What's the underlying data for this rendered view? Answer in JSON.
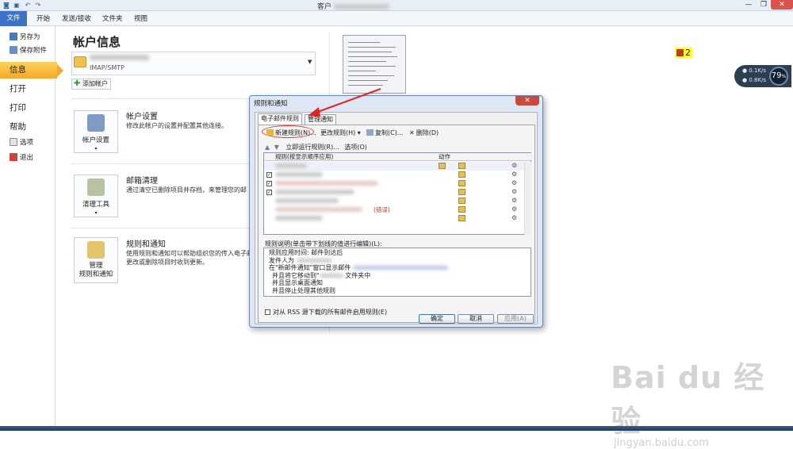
{
  "window": {
    "title": "客户",
    "quick_access": [
      "save-icon",
      "undo-icon",
      "redo-icon"
    ],
    "controls": [
      "—",
      "❐",
      "✕"
    ]
  },
  "ribbon": {
    "tabs": [
      "文件",
      "开始",
      "发送/接收",
      "文件夹",
      "视图"
    ]
  },
  "nav": {
    "save_as": "另存为",
    "save_attachments": "保存附件",
    "info": "信息",
    "open": "打开",
    "print": "打印",
    "help": "帮助",
    "options": "选项",
    "exit": "退出"
  },
  "main": {
    "heading": "帐户信息",
    "account_type": "IMAP/SMTP",
    "add_account": "添加帐户",
    "sections": [
      {
        "button": "帐户设置",
        "title": "帐户设置",
        "desc": "修改此帐户的设置并配置其他连接。"
      },
      {
        "button": "清理工具",
        "title": "邮箱清理",
        "desc": "通过清空已删除项目并存档，来管理您的邮"
      },
      {
        "button_line1": "管理",
        "button_line2": "规则和通知",
        "title": "规则和通知",
        "desc1": "使用规则和通知可以帮助组织您的传入电子邮",
        "desc2": "更改或删除项目时收到更新。"
      }
    ]
  },
  "badge": {
    "count": "2"
  },
  "network": {
    "up": "0.1",
    "down": "0.8",
    "unit": "K/s",
    "percent": "79",
    "percent_unit": "%"
  },
  "dialog": {
    "title": "规则和通知",
    "close": "✕",
    "tabs": [
      "电子邮件规则",
      "管理通知"
    ],
    "toolbar": {
      "new_rule": "新建规则(N)...",
      "change_rule": "更改规则(H) ▾",
      "copy": "复制(C)...",
      "delete": "删除(D)"
    },
    "run_rules": "立即运行规则(R)...",
    "options": "选项(O)",
    "table": {
      "col_rule": "规则(按显示顺序应用)",
      "col_action": "动作",
      "rows": [
        "",
        "",
        "",
        "",
        "",
        "",
        "(错误)"
      ]
    },
    "desc_label": "规则说明(单击带下划线的值进行编辑)(L):",
    "desc_lines": [
      "规则应用时间: 邮件到达后",
      "发件人为",
      "在\"新邮件通知\"窗口显示邮件",
      "并且将它移动到\"",
      "文件夹中",
      "并且显示桌面通知",
      "并且停止处理其他规则"
    ],
    "rss": "对从 RSS 源下载的所有邮件启用规则(E)",
    "ok": "确定",
    "cancel": "取消",
    "apply": "应用(A)"
  },
  "watermark": {
    "logo": "Bai du 经验",
    "url": "jingyan.baidu.com"
  }
}
